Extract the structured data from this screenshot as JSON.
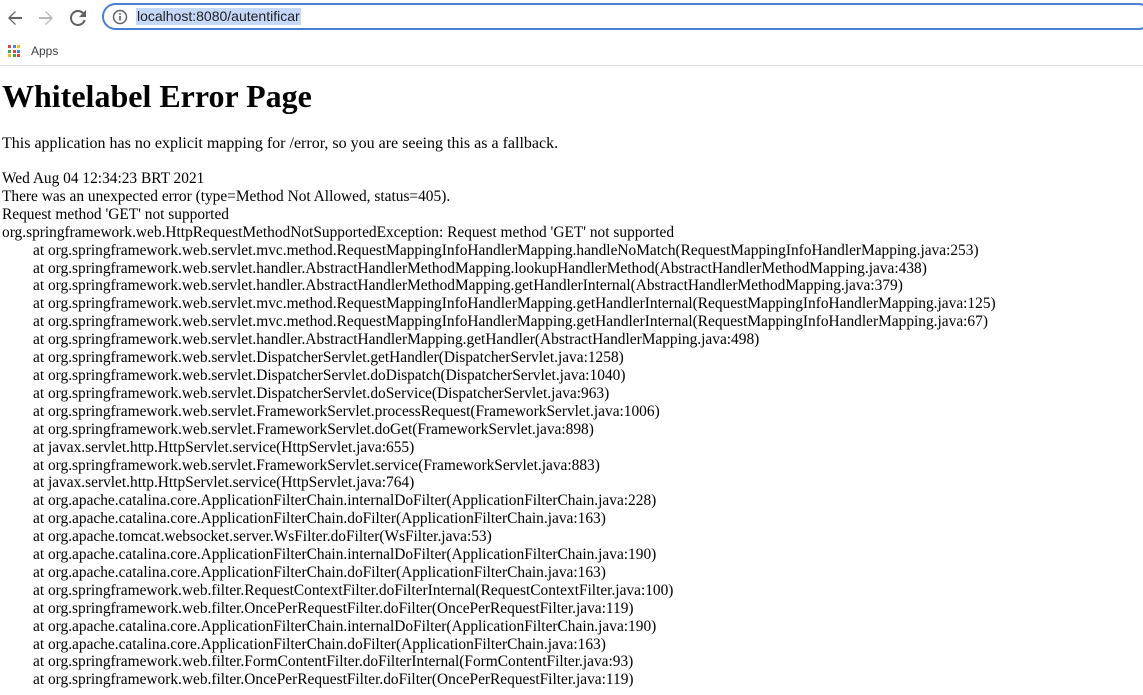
{
  "browser": {
    "url": "localhost:8080/autentificar",
    "bookmarks": [
      {
        "label": "Apps"
      }
    ]
  },
  "page": {
    "title": "Whitelabel Error Page",
    "fallback_message": "This application has no explicit mapping for /error, so you are seeing this as a fallback.",
    "timestamp": "Wed Aug 04 12:34:23 BRT 2021",
    "error_summary": "There was an unexpected error (type=Method Not Allowed, status=405).",
    "message": "Request method 'GET' not supported",
    "exception": "org.springframework.web.HttpRequestMethodNotSupportedException: Request method 'GET' not supported",
    "stack_trace": [
      "at org.springframework.web.servlet.mvc.method.RequestMappingInfoHandlerMapping.handleNoMatch(RequestMappingInfoHandlerMapping.java:253)",
      "at org.springframework.web.servlet.handler.AbstractHandlerMethodMapping.lookupHandlerMethod(AbstractHandlerMethodMapping.java:438)",
      "at org.springframework.web.servlet.handler.AbstractHandlerMethodMapping.getHandlerInternal(AbstractHandlerMethodMapping.java:379)",
      "at org.springframework.web.servlet.mvc.method.RequestMappingInfoHandlerMapping.getHandlerInternal(RequestMappingInfoHandlerMapping.java:125)",
      "at org.springframework.web.servlet.mvc.method.RequestMappingInfoHandlerMapping.getHandlerInternal(RequestMappingInfoHandlerMapping.java:67)",
      "at org.springframework.web.servlet.handler.AbstractHandlerMapping.getHandler(AbstractHandlerMapping.java:498)",
      "at org.springframework.web.servlet.DispatcherServlet.getHandler(DispatcherServlet.java:1258)",
      "at org.springframework.web.servlet.DispatcherServlet.doDispatch(DispatcherServlet.java:1040)",
      "at org.springframework.web.servlet.DispatcherServlet.doService(DispatcherServlet.java:963)",
      "at org.springframework.web.servlet.FrameworkServlet.processRequest(FrameworkServlet.java:1006)",
      "at org.springframework.web.servlet.FrameworkServlet.doGet(FrameworkServlet.java:898)",
      "at javax.servlet.http.HttpServlet.service(HttpServlet.java:655)",
      "at org.springframework.web.servlet.FrameworkServlet.service(FrameworkServlet.java:883)",
      "at javax.servlet.http.HttpServlet.service(HttpServlet.java:764)",
      "at org.apache.catalina.core.ApplicationFilterChain.internalDoFilter(ApplicationFilterChain.java:228)",
      "at org.apache.catalina.core.ApplicationFilterChain.doFilter(ApplicationFilterChain.java:163)",
      "at org.apache.tomcat.websocket.server.WsFilter.doFilter(WsFilter.java:53)",
      "at org.apache.catalina.core.ApplicationFilterChain.internalDoFilter(ApplicationFilterChain.java:190)",
      "at org.apache.catalina.core.ApplicationFilterChain.doFilter(ApplicationFilterChain.java:163)",
      "at org.springframework.web.filter.RequestContextFilter.doFilterInternal(RequestContextFilter.java:100)",
      "at org.springframework.web.filter.OncePerRequestFilter.doFilter(OncePerRequestFilter.java:119)",
      "at org.apache.catalina.core.ApplicationFilterChain.internalDoFilter(ApplicationFilterChain.java:190)",
      "at org.apache.catalina.core.ApplicationFilterChain.doFilter(ApplicationFilterChain.java:163)",
      "at org.springframework.web.filter.FormContentFilter.doFilterInternal(FormContentFilter.java:93)",
      "at org.springframework.web.filter.OncePerRequestFilter.doFilter(OncePerRequestFilter.java:119)"
    ]
  },
  "icons": {
    "back": "arrow-left-icon",
    "forward": "arrow-right-icon",
    "reload": "reload-icon",
    "site_info": "info-icon",
    "apps": "apps-grid-icon"
  },
  "colors": {
    "omnibox_border": "#4a7fd6",
    "url_selection": "#c5d8f7",
    "apps_grid": [
      "#ea4335",
      "#4285f4",
      "#fbbc05",
      "#34a853",
      "#ea4335",
      "#4285f4",
      "#fbbc05",
      "#34a853",
      "#ea4335"
    ]
  }
}
